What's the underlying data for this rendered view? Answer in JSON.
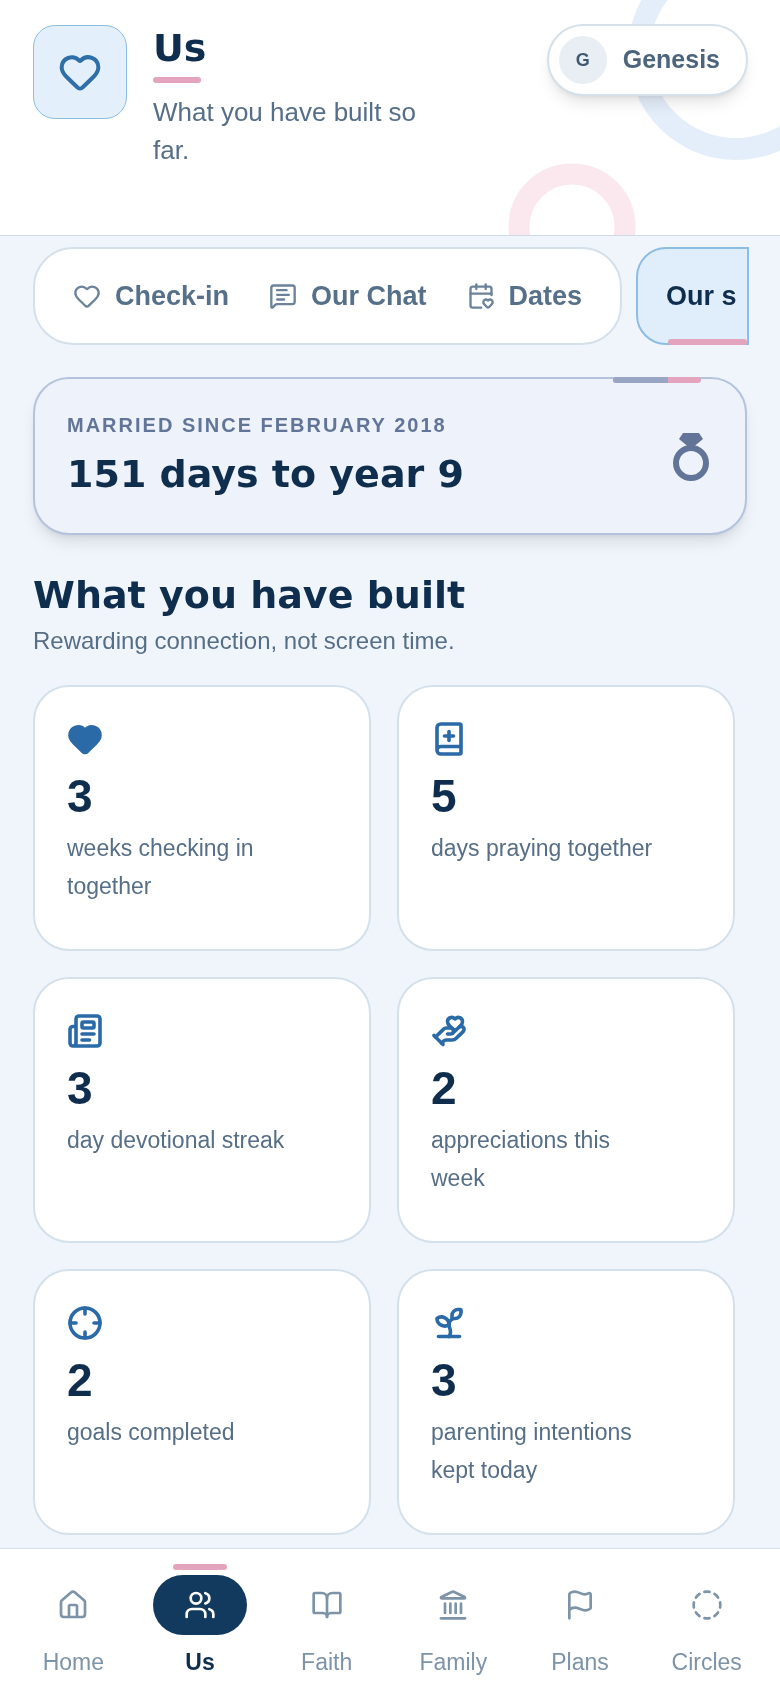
{
  "header": {
    "title": "Us",
    "subtitle": "What you have built so far.",
    "profile": {
      "initial": "G",
      "name": "Genesis"
    }
  },
  "tabs": [
    {
      "label": "Check-in",
      "selected": false
    },
    {
      "label": "Our Chat",
      "selected": false
    },
    {
      "label": "Dates",
      "selected": false
    },
    {
      "label": "Our s",
      "selected": true
    }
  ],
  "anniversary": {
    "label": "MARRIED SINCE FEBRUARY 2018",
    "countdown": "151 days to year 9",
    "level": 0.63
  },
  "section": {
    "title": "What you have built",
    "subtitle": "Rewarding connection, not screen time."
  },
  "stats": [
    {
      "value": "3",
      "label": "weeks checking in together"
    },
    {
      "value": "5",
      "label": "days praying together"
    },
    {
      "value": "3",
      "label": "day devotional streak"
    },
    {
      "value": "2",
      "label": "appreciations this week"
    },
    {
      "value": "2",
      "label": "goals completed"
    },
    {
      "value": "3",
      "label": "parenting intentions kept today"
    }
  ],
  "nav": [
    {
      "label": "Home",
      "selected": false
    },
    {
      "label": "Us",
      "selected": true
    },
    {
      "label": "Faith",
      "selected": false
    },
    {
      "label": "Family",
      "selected": false
    },
    {
      "label": "Plans",
      "selected": false
    },
    {
      "label": "Circles",
      "selected": false
    }
  ]
}
